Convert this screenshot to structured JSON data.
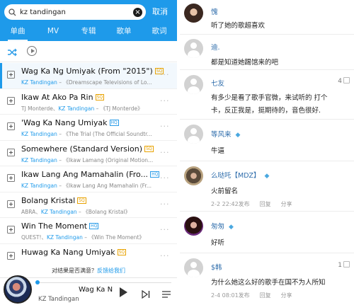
{
  "search": {
    "query": "kz tandingan",
    "cancel_label": "取消"
  },
  "tabs": [
    {
      "label": "单曲",
      "active": true
    },
    {
      "label": "MV"
    },
    {
      "label": "专辑"
    },
    {
      "label": "歌单"
    },
    {
      "label": "歌词"
    }
  ],
  "songs": [
    {
      "title": "Wag Ka Ng Umiyak (From \"2015\")",
      "badge": "SQ",
      "artist": "KZ Tandingan",
      "rest": " – 《Dreamscape Televisions of Lo..."
    },
    {
      "title": "Ikaw At Ako Pa Rin",
      "badge": "SQ",
      "prefix": "TJ Monterde、",
      "artist": "KZ Tandingan",
      "rest": " – 《TJ Monterde》"
    },
    {
      "title": "'Wag Ka Nang Umiyak",
      "badge": "HQ",
      "artist": "KZ Tandingan",
      "rest": " – 《The Trial (The Official Soundtr..."
    },
    {
      "title": "Somewhere (Standard Version)",
      "badge": "SQ",
      "artist": "KZ Tandingan",
      "rest": " – 《Ikaw Lamang (Original Motion..."
    },
    {
      "title": "Ikaw Lang Ang Mamahalin (Fro...",
      "badge": "HQ",
      "artist": "KZ Tandingan",
      "rest": " – 《Ikaw Lang Ang Mamahalin (Fr..."
    },
    {
      "title": "Bolang Kristal",
      "badge": "SQ",
      "prefix": "ABRA、",
      "artist": "KZ Tandingan",
      "rest": " – 《Bolang Kristal》"
    },
    {
      "title": "Win The Moment",
      "badge": "HQ",
      "prefix": "QUEST!、",
      "artist": "KZ Tandingan",
      "rest": " – 《Win The Moment》"
    },
    {
      "title": "Huwag Ka Nang Umiyak",
      "badge": "SQ",
      "artist": "",
      "rest": ""
    }
  ],
  "feedback": {
    "text": "对结果是否满意？",
    "link": "反馈给我们"
  },
  "player": {
    "title": "Wag Ka N",
    "artist": "KZ Tandingan",
    "progress": 0
  },
  "comments": [
    {
      "name": "愧",
      "text": "听了她的歌超喜欢"
    },
    {
      "name": "迪.",
      "text": "都是知道她踢馆来的吧"
    },
    {
      "name": "七友",
      "text": "有多少是看了歌手官微，来试听的 打个",
      "text2": "卡，反正我是，挺期待的，音色很好.",
      "likes": "4"
    },
    {
      "name": "等风来",
      "text": "牛逼",
      "vip": true
    },
    {
      "name": "么哒吒【MDZ】",
      "text": "火前留名",
      "vip": true,
      "time": "2-2 22:42发布",
      "reply": "回复",
      "share": "分享"
    },
    {
      "name": "匆匆",
      "text": "好听",
      "vip": true
    },
    {
      "name": "$韩",
      "text": "为什么她这么好的歌手在国不为人所知",
      "likes": "1",
      "time": "2-4 08:01发布",
      "reply": "回复",
      "share": "分享"
    }
  ]
}
